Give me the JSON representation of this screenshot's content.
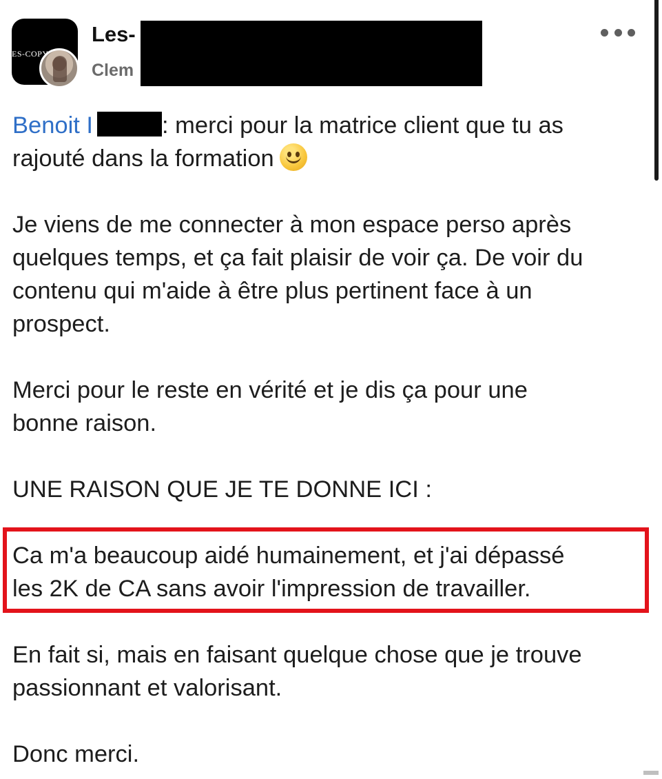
{
  "header": {
    "group_name": "Les-",
    "member_name": "Clem",
    "group_avatar_text": "ES-COPY",
    "more_icon": "more-horizontal-icon"
  },
  "post": {
    "mention": "Benoit I",
    "line1_rest": ": merci pour la matrice client que tu as",
    "line2": "rajouté dans la formation",
    "emoji": "slightly-smiling-face-icon",
    "p2": [
      "Je viens de me connecter à mon espace perso après",
      "quelques temps, et ça fait plaisir de voir ça. De voir du",
      "contenu qui m'aide à être plus pertinent face à un",
      "prospect."
    ],
    "p3": [
      "Merci pour le reste en vérité et je dis ça pour une",
      "bonne raison."
    ],
    "p4": "UNE RAISON QUE JE TE DONNE ICI :",
    "p5": [
      "Ca m'a beaucoup aidé humainement, et j'ai dépassé",
      "les 2K de CA sans avoir l'impression de travailler."
    ],
    "p6": [
      "En fait si, mais en faisant quelque chose que je trouve",
      "passionnant et valorisant."
    ],
    "p7": "Donc merci."
  },
  "colors": {
    "mention": "#2f6fc7",
    "highlight_border": "#e3131b",
    "text": "#1d1d1d",
    "secondary_text": "#6b6b6b"
  }
}
